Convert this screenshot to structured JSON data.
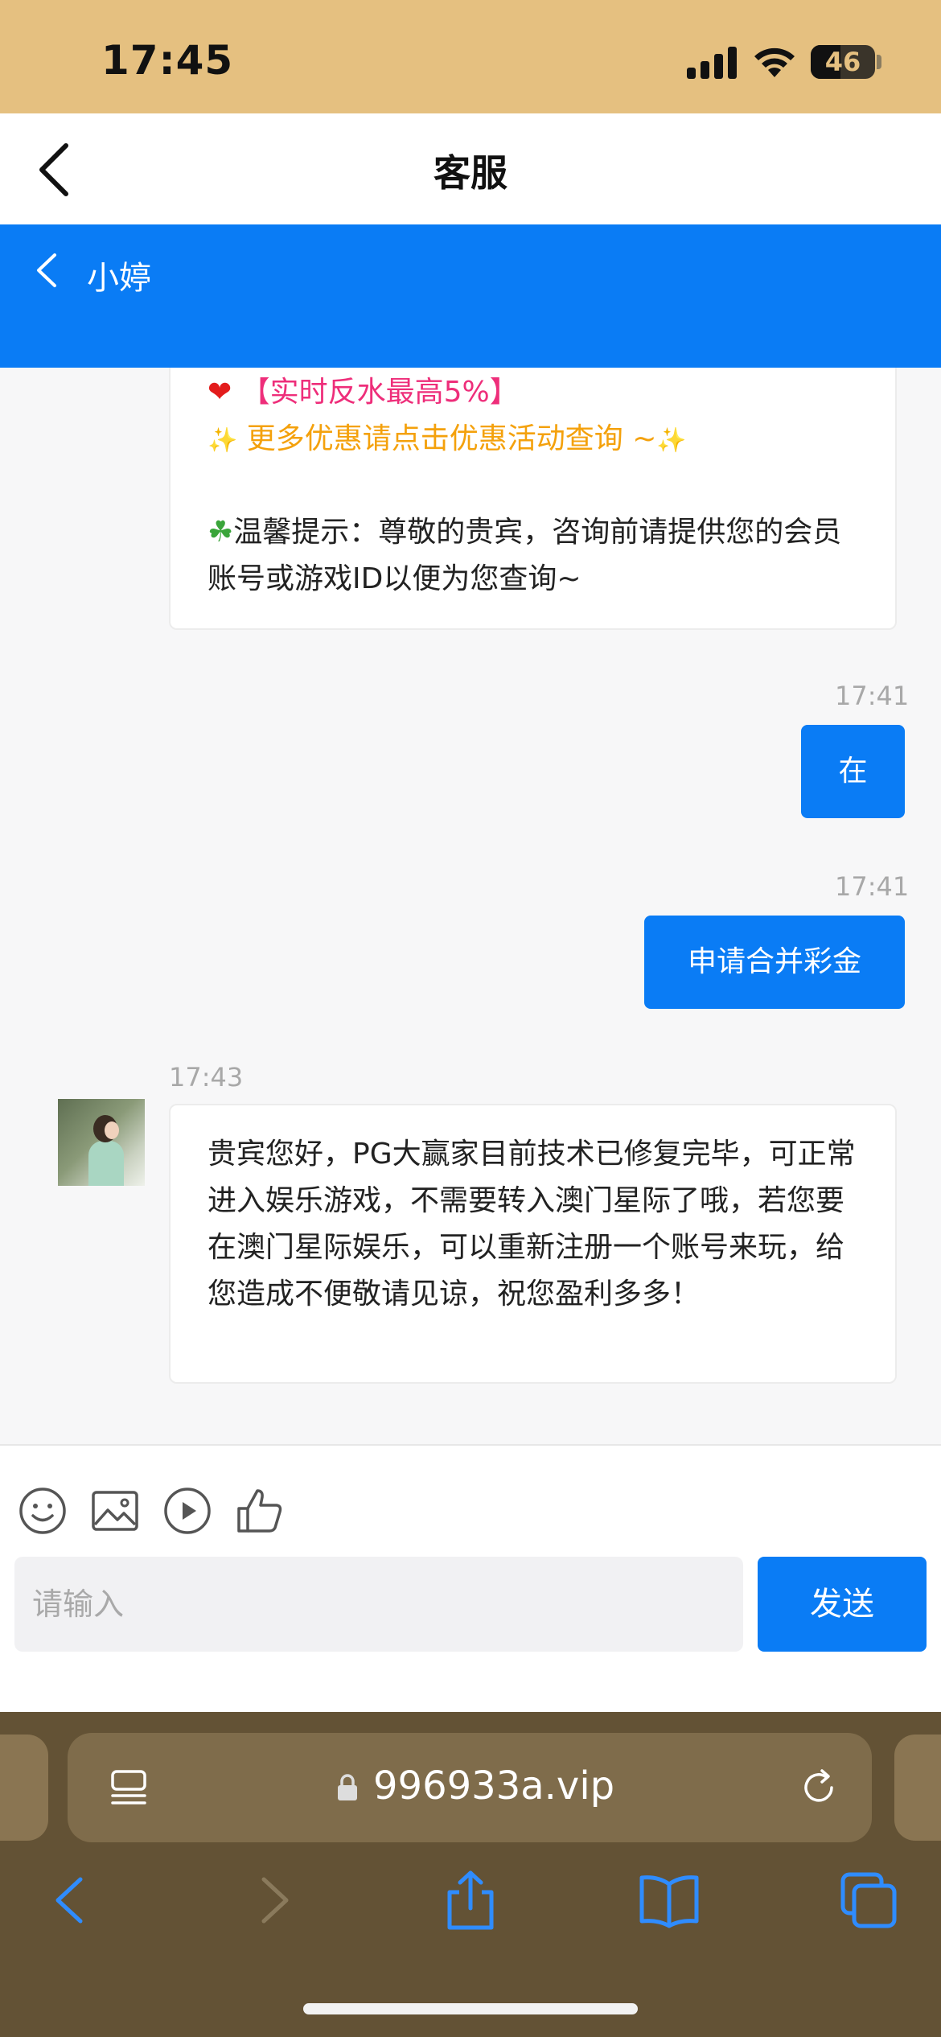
{
  "status_bar": {
    "time": "17:45",
    "battery": "46"
  },
  "nav": {
    "title": "客服"
  },
  "chat_header": {
    "agent_name": "小婷"
  },
  "messages": {
    "welcome": {
      "promo_rebate": "【实时反水最高5%】",
      "promo_more": " 更多优惠请点击优惠活动查询 ~",
      "tip": "温馨提示：尊敬的贵宾，咨询前请提供您的会员账号或游戏ID以便为您查询~"
    },
    "m1": {
      "time": "17:41",
      "text": "在"
    },
    "m2": {
      "time": "17:41",
      "text": "申请合并彩金"
    },
    "m3": {
      "time": "17:43",
      "text": "贵宾您好，PG大赢家目前技术已修复完毕，可正常进入娱乐游戏，不需要转入澳门星际了哦，若您要在澳门星际娱乐，可以重新注册一个账号来玩，给您造成不便敬请见谅，祝您盈利多多！"
    }
  },
  "composer": {
    "placeholder": "请输入",
    "send_label": "发送"
  },
  "browser": {
    "url": "996933a.vip"
  },
  "colors": {
    "accent": "#0a7cf5",
    "status_bar": "#e5c080",
    "browser_bar": "#635235",
    "promo_pink": "#ee2e7a",
    "promo_orange": "#f4a10c"
  }
}
